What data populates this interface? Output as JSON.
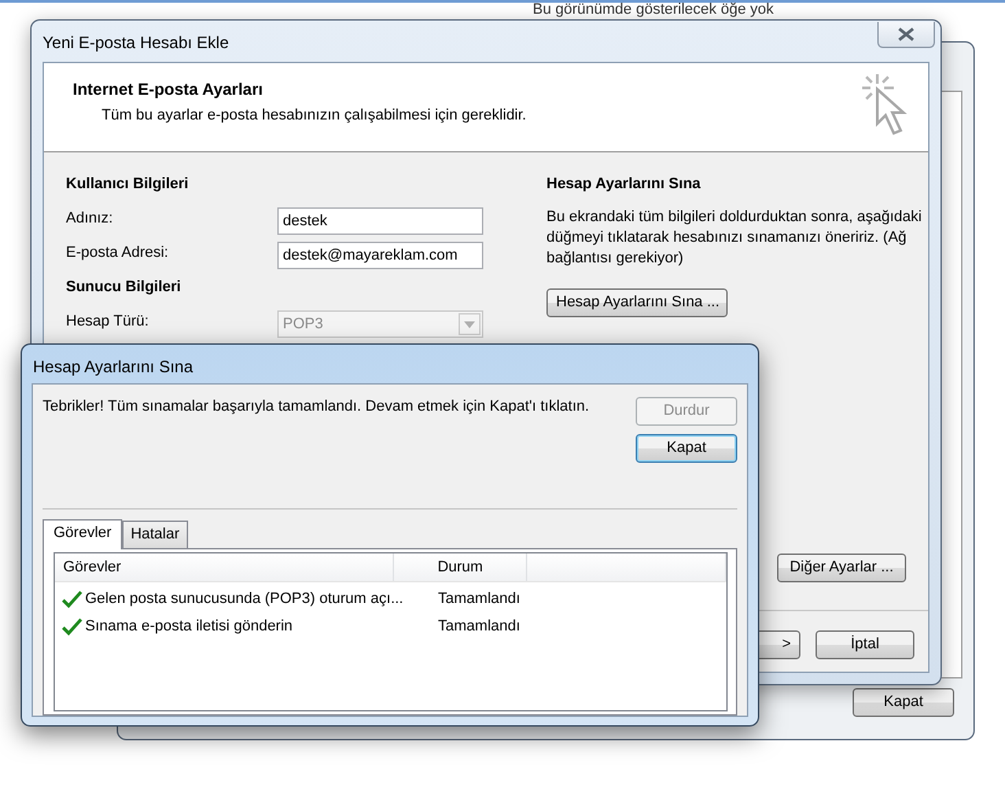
{
  "background_text": "Bu görünümde gösterilecek öğe yok",
  "back_window": {
    "buttons": [
      "Kapat"
    ]
  },
  "main_window": {
    "title": "Yeni E-posta Hesabı Ekle",
    "header": {
      "title": "Internet E-posta Ayarları",
      "subtitle": "Tüm bu ayarlar e-posta hesabınızın çalışabilmesi için gereklidir."
    },
    "sections": [
      {
        "title": "Kullanıcı Bilgileri",
        "fields": [
          {
            "label": "Adınız:",
            "value": "destek",
            "kind": "text",
            "disabled": false
          },
          {
            "label": "E-posta Adresi:",
            "value": "destek@mayareklam.com",
            "kind": "text",
            "disabled": false
          }
        ]
      },
      {
        "title": "Sunucu Bilgileri",
        "fields": [
          {
            "label": "Hesap Türü:",
            "value": "POP3",
            "kind": "dropdown",
            "disabled": true
          }
        ]
      }
    ],
    "test_section": {
      "title": "Hesap Ayarlarını Sına",
      "text": "Bu ekrandaki tüm bilgileri doldurduktan sonra, aşağıdaki düğmeyi tıklatarak hesabınızı sınamanızı öneririz. (Ağ bağlantısı gerekiyor)",
      "button": "Hesap Ayarlarını Sına ..."
    },
    "more_settings_button": "Diğer Ayarlar ...",
    "footer_buttons": [
      ">",
      "İptal"
    ]
  },
  "test_dialog": {
    "title": "Hesap Ayarlarını Sına",
    "message": "Tebrikler! Tüm sınamalar başarıyla tamamlandı. Devam etmek için Kapat'ı tıklatın.",
    "buttons": [
      {
        "label": "Durdur",
        "disabled": true,
        "default": false
      },
      {
        "label": "Kapat",
        "disabled": false,
        "default": true
      }
    ],
    "tabs": [
      {
        "label": "Görevler",
        "selected": true
      },
      {
        "label": "Hatalar",
        "selected": false
      }
    ],
    "columns": [
      "Görevler",
      "Durum"
    ],
    "rows": [
      {
        "task": "Gelen posta sunucusunda (POP3) oturum açı...",
        "status": "Tamamlandı",
        "done": true
      },
      {
        "task": "Sınama e-posta iletisi gönderin",
        "status": "Tamamlandı",
        "done": true
      }
    ]
  }
}
